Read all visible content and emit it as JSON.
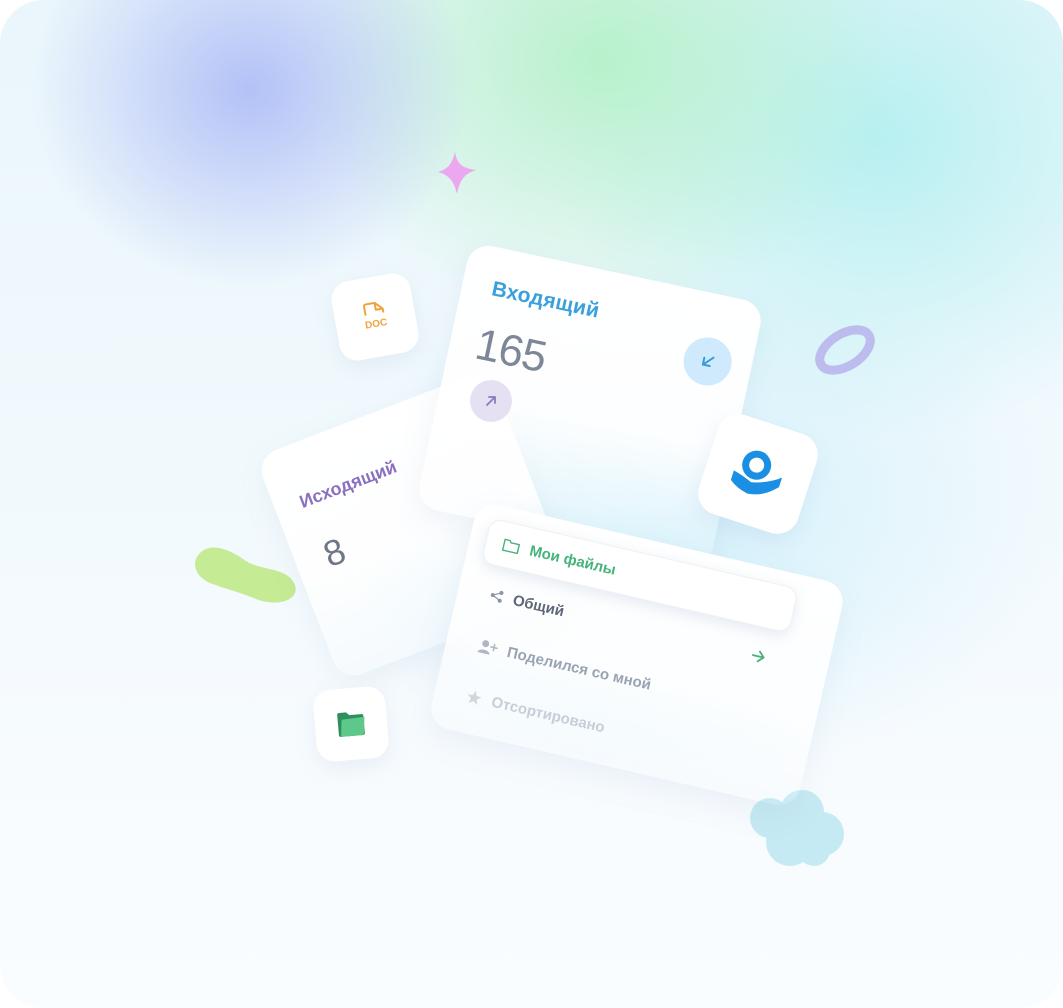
{
  "cards": {
    "incoming": {
      "title": "Входящий",
      "count": "165"
    },
    "outgoing": {
      "title": "Исходящий",
      "count": "8"
    }
  },
  "menu": {
    "items": [
      {
        "label": "Мои файлы",
        "icon": "folder-icon",
        "active": true
      },
      {
        "label": "Общий",
        "icon": "share-icon"
      },
      {
        "label": "Поделился со мной",
        "icon": "user-add-icon"
      },
      {
        "label": "Отсортировано",
        "icon": "star-icon"
      }
    ]
  },
  "tiles": {
    "doc": {
      "text": "DOC",
      "icon": "doc-file-icon"
    },
    "brand": {
      "icon": "brand-logo-icon"
    },
    "folder": {
      "icon": "green-folder-icon"
    }
  },
  "colors": {
    "incoming_accent": "#3aa0dd",
    "outgoing_accent": "#8a6fc2",
    "active_menu": "#46b37a",
    "doc_orange": "#f2a23a",
    "brand_blue": "#1a8fe3"
  }
}
